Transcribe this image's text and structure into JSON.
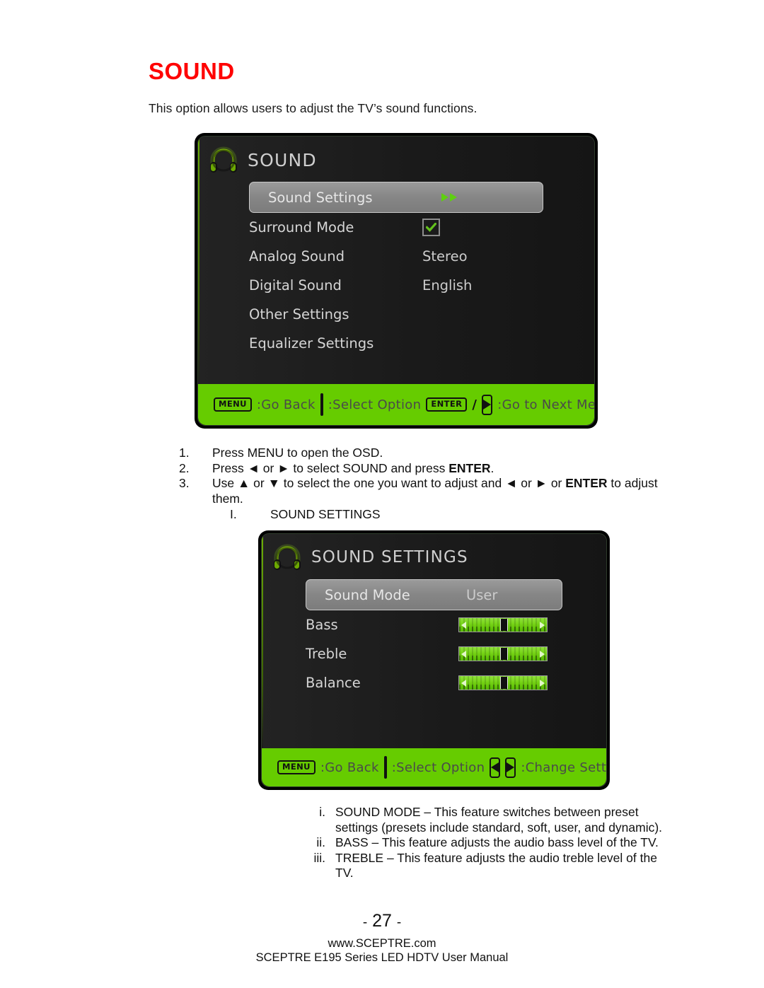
{
  "page": {
    "title": "SOUND",
    "title_color": "#ff0000",
    "intro": "This option allows users to adjust the TV’s sound functions.",
    "page_number": "27",
    "page_number_prefix": "-",
    "page_number_suffix": "-",
    "website": "www.SCEPTRE.com",
    "manual_line": "SCEPTRE E195 Series LED HDTV User Manual"
  },
  "osd_sound": {
    "title": "SOUND",
    "icon": "headphones-icon",
    "accent_color": "#66cc00",
    "rows": [
      {
        "label": "Sound Settings",
        "value": "",
        "type": "submenu",
        "highlight": true
      },
      {
        "label": "Surround Mode",
        "value": "",
        "type": "checkbox",
        "checked": true,
        "highlight": false
      },
      {
        "label": "Analog Sound",
        "value": "Stereo",
        "type": "value",
        "highlight": false
      },
      {
        "label": "Digital Sound",
        "value": "English",
        "type": "value",
        "highlight": false
      },
      {
        "label": "Other Settings",
        "value": "",
        "type": "plain",
        "highlight": false
      },
      {
        "label": "Equalizer Settings",
        "value": "",
        "type": "plain",
        "highlight": false
      }
    ],
    "footer": {
      "key_menu": "MENU",
      "menu_action": ":Go Back",
      "updown_action": ":Select Option",
      "key_enter": "ENTER",
      "slash": "/",
      "enter_action": ":Go to Next Menu"
    }
  },
  "steps": [
    {
      "num": "1.",
      "text": "Press MENU to open the OSD."
    },
    {
      "num": "2.",
      "text": "Press ◄ or ► to select SOUND and press ENTER."
    },
    {
      "num": "3.",
      "text": "Use ▲ or ▼ to select the one you want to adjust and ◄ or ► or ENTER to adjust them."
    }
  ],
  "sub_item": {
    "num": "I.",
    "text": "SOUND SETTINGS"
  },
  "osd_sound_settings": {
    "title": "SOUND SETTINGS",
    "icon": "headphones-icon",
    "accent_color": "#66cc00",
    "rows": [
      {
        "label": "Sound Mode",
        "value": "User",
        "type": "value",
        "highlight": true
      },
      {
        "label": "Bass",
        "value": "",
        "type": "slider",
        "slider_percent": 50,
        "highlight": false
      },
      {
        "label": "Treble",
        "value": "",
        "type": "slider",
        "slider_percent": 50,
        "highlight": false
      },
      {
        "label": "Balance",
        "value": "",
        "type": "slider",
        "slider_percent": 50,
        "highlight": false
      }
    ],
    "footer": {
      "key_menu": "MENU",
      "menu_action": ":Go Back",
      "updown_action": ":Select Option",
      "leftright_action": ":Change Setting"
    }
  },
  "definitions": [
    {
      "num": "i.",
      "text": "SOUND MODE – This feature switches between preset settings (presets include standard, soft, user, and dynamic)."
    },
    {
      "num": "ii.",
      "text": "BASS – This feature adjusts the audio bass level of the TV."
    },
    {
      "num": "iii.",
      "text": "TREBLE – This feature adjusts the audio treble level of the TV."
    }
  ]
}
